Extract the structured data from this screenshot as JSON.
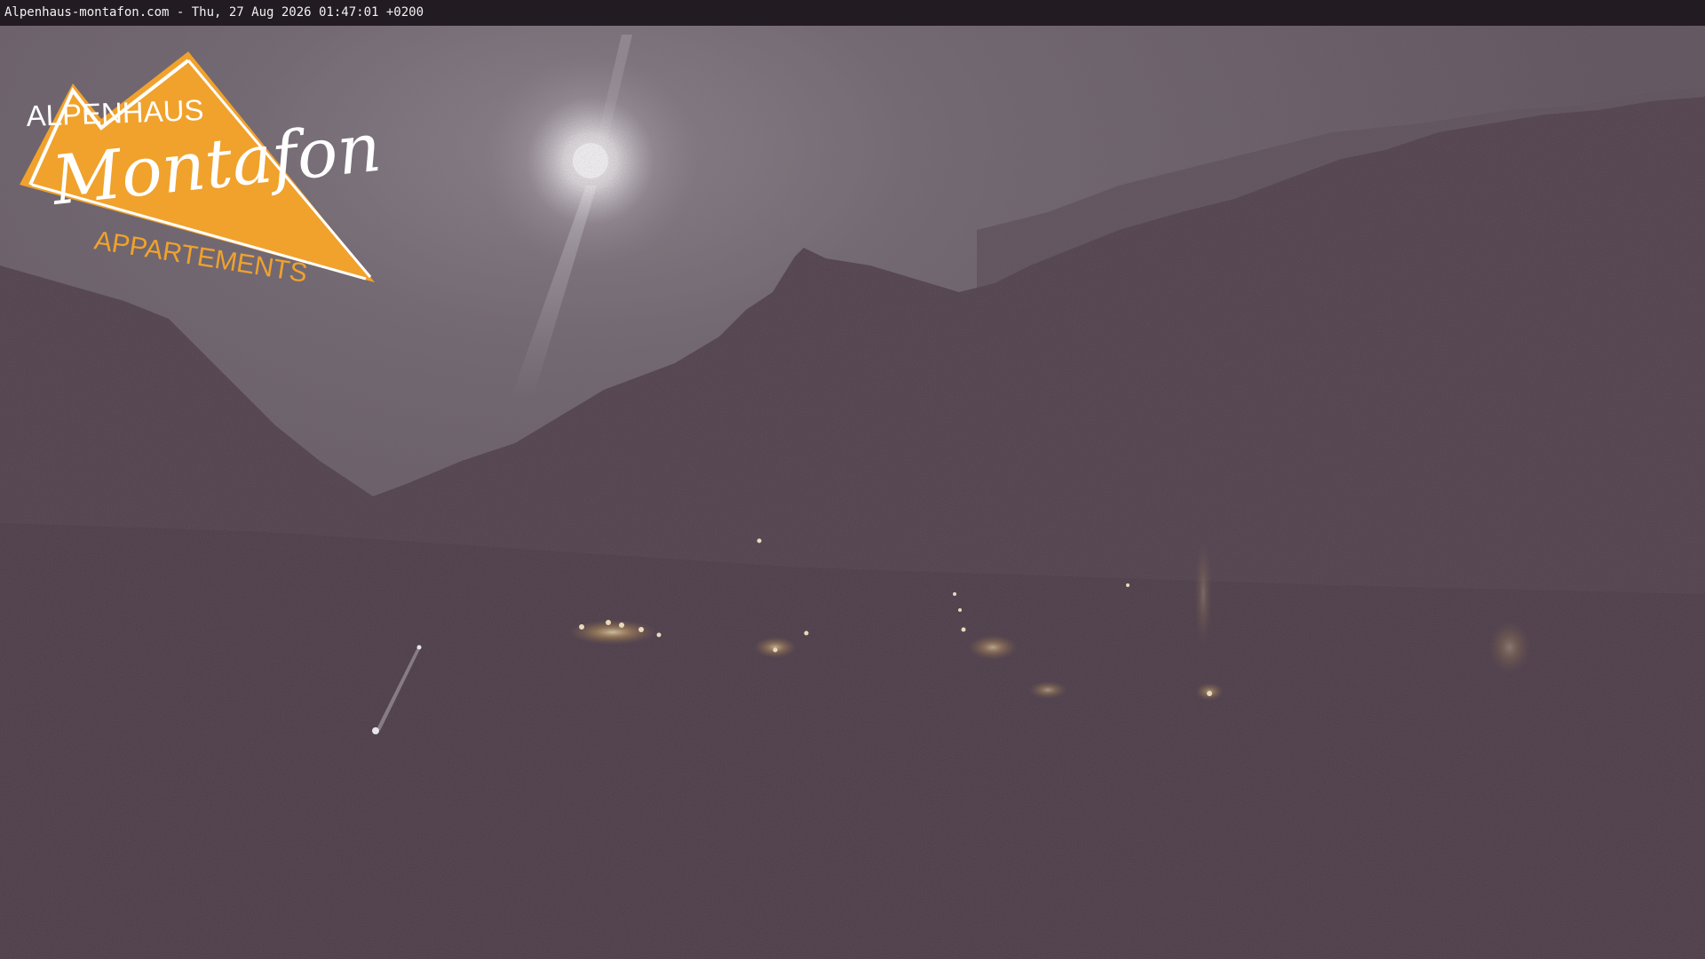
{
  "caption": {
    "text": "Alpenhaus-montafon.com - Thu, 27 Aug 2026 01:47:01 +0200"
  },
  "logo": {
    "top_line": "ALPENHAUS",
    "script_line": "Montafon",
    "bottom_line": "APPARTEMENTS",
    "accent_color": "#f0a22c",
    "text_color": "#ffffff"
  },
  "scene": {
    "description_colors": {
      "sky": "#6b616b",
      "mountain": "#4d3e49",
      "foreground": "#483a45",
      "moon": "#ffffff",
      "village_light": "#ffd98a"
    }
  }
}
